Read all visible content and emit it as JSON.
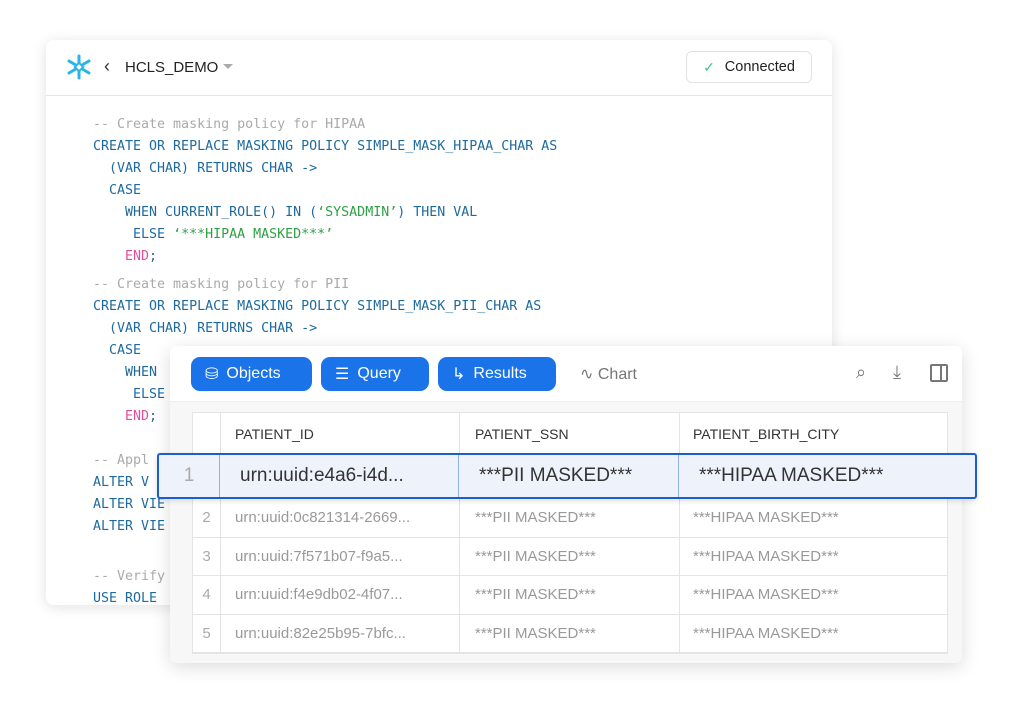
{
  "header": {
    "database": "HCLS_DEMO",
    "status": "Connected"
  },
  "code": [
    {
      "t": "-- Create masking policy for HIPAA",
      "k": "cm"
    },
    {
      "t": "CREATE OR REPLACE MASKING POLICY SIMPLE_MASK_HIPAA_CHAR AS",
      "k": ""
    },
    {
      "t": "  (VAR CHAR) RETURNS CHAR ->",
      "k": ""
    },
    {
      "t": "  CASE",
      "k": ""
    },
    {
      "t": "    WHEN CURRENT_ROLE() IN (",
      "k": "",
      "s": "‘SYSADMIN’",
      "r": ") THEN VAL"
    },
    {
      "t": "     ELSE ",
      "k": "",
      "s": "‘***HIPAA MASKED***’",
      "r": ""
    },
    {
      "t": "    END",
      "k": "kw2",
      "r": ";"
    },
    {
      "t": "-- Create masking policy for PII",
      "k": "cm"
    },
    {
      "t": "CREATE OR REPLACE MASKING POLICY SIMPLE_MASK_PII_CHAR AS",
      "k": ""
    },
    {
      "t": "  (VAR CHAR) RETURNS CHAR ->",
      "k": ""
    },
    {
      "t": "  CASE",
      "k": ""
    },
    {
      "t": "    WHEN",
      "k": ""
    },
    {
      "t": "     ELSE",
      "k": ""
    },
    {
      "t": "    END",
      "k": "kw2",
      "r": ";"
    },
    {
      "t": "",
      "k": ""
    },
    {
      "t": "-- Appl",
      "k": "cm"
    },
    {
      "t": "ALTER V",
      "k": ""
    },
    {
      "t": "ALTER VIE",
      "k": ""
    },
    {
      "t": "ALTER VIE",
      "k": ""
    },
    {
      "t": "",
      "k": ""
    },
    {
      "t": "-- Verify",
      "k": "cm"
    },
    {
      "t": "USE ROLE",
      "k": ""
    }
  ],
  "toolbar": {
    "objects": "Objects",
    "query": "Query",
    "results": "Results",
    "chart": "Chart"
  },
  "table": {
    "columns": [
      "PATIENT_ID",
      "PATIENT_SSN",
      "PATIENT_BIRTH_CITY"
    ],
    "selected": {
      "n": "1",
      "id": "urn:uuid:e4a6-i4d...",
      "ssn": "***PII MASKED***",
      "city": "***HIPAA MASKED***"
    },
    "rows": [
      {
        "n": "2",
        "id": "urn:uuid:0c821314-2669...",
        "ssn": "***PII MASKED***",
        "city": "***HIPAA MASKED***"
      },
      {
        "n": "3",
        "id": "urn:uuid:7f571b07-f9a5...",
        "ssn": "***PII MASKED***",
        "city": "***HIPAA MASKED***"
      },
      {
        "n": "4",
        "id": "urn:uuid:f4e9db02-4f07...",
        "ssn": "***PII MASKED***",
        "city": "***HIPAA MASKED***"
      },
      {
        "n": "5",
        "id": "urn:uuid:82e25b95-7bfc...",
        "ssn": "***PII MASKED***",
        "city": "***HIPAA MASKED***"
      }
    ]
  },
  "colors": {
    "accent": "#1a73e8",
    "code_keyword": "#1e6a9e",
    "code_string": "#2ea043",
    "code_comment": "#aaaaaa",
    "connected": "#3cc68a"
  }
}
